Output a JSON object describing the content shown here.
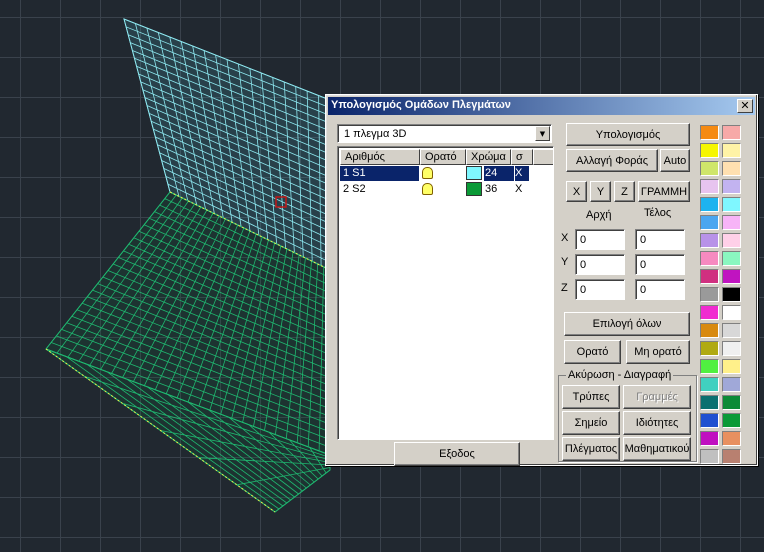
{
  "dialog": {
    "title": "Υπολογισμός Ομάδων Πλεγμάτων",
    "close_label": "✕",
    "combo_value": "1 πλεγμα 3D",
    "list": {
      "headers": [
        "Αριθμός",
        "Ορατό",
        "Χρώμα",
        "σ"
      ],
      "rows": [
        {
          "num": "1  S1",
          "color_index": "24",
          "sigma": "X",
          "swatch": "#7ff7ff",
          "selected": true
        },
        {
          "num": "2  S2",
          "color_index": "36",
          "sigma": "X",
          "swatch": "#0b9a37",
          "selected": false
        }
      ]
    },
    "buttons": {
      "compute": "Υπολογισμός",
      "change_direction": "Αλλαγή Φοράς",
      "auto": "Auto",
      "x": "X",
      "y": "Y",
      "z": "Z",
      "line": "ΓΡΑΜΜΗ",
      "select_all": "Επιλογή όλων",
      "visible": "Ορατό",
      "not_visible": "Μη ορατό",
      "holes": "Τρύπες",
      "lines": "Γραμμές",
      "point": "Σημείο",
      "properties": "Ιδιότητες",
      "mesh": "Πλέγματος",
      "math": "Μαθηματικού",
      "exit": "Εξοδος"
    },
    "labels": {
      "start": "Αρχή",
      "end": "Τέλος",
      "x": "X",
      "y": "Y",
      "z": "Z",
      "group": "Ακύρωση - Διαγραφή"
    },
    "coords": {
      "x_start": "0",
      "x_end": "0",
      "y_start": "0",
      "y_end": "0",
      "z_start": "0",
      "z_end": "0"
    },
    "palette": [
      "#f58a12",
      "#f7a9a8",
      "#f6f600",
      "#fff3a6",
      "#cfe66a",
      "#ffe0b0",
      "#e7c4ef",
      "#c2b3f0",
      "#1db3ef",
      "#7ff7ff",
      "#4aa6f0",
      "#f7b4f7",
      "#b892e8",
      "#ffd0e8",
      "#f68ac0",
      "#8af7c0",
      "#d03080",
      "#c014c0",
      "#9a9a9a",
      "#000000",
      "#f02bd0",
      "#ffffff",
      "#d88a10",
      "#d8d8d8",
      "#b0aa12",
      "#f0f0f0",
      "#50f040",
      "#fff08a",
      "#40d0c0",
      "#a0a8d8",
      "#0a7070",
      "#0b8a37",
      "#2050d0",
      "#0b9a37",
      "#c010c0",
      "#e89060",
      "#c0c0c0",
      "#b88070"
    ]
  }
}
